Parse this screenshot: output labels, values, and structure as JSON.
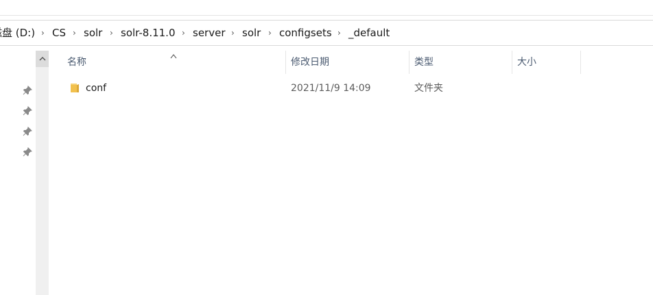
{
  "breadcrumb": {
    "items": [
      "磁盘 (D:)",
      "CS",
      "solr",
      "solr-8.11.0",
      "server",
      "solr",
      "configsets",
      "_default"
    ],
    "separator_icon": "chevron-right-icon"
  },
  "columns": {
    "name": "名称",
    "modified": "修改日期",
    "type": "类型",
    "size": "大小"
  },
  "files": [
    {
      "name": "conf",
      "modified": "2021/11/9 14:09",
      "type": "文件夹",
      "size": "",
      "icon": "folder-icon"
    }
  ],
  "quick_access_pins": 4,
  "colors": {
    "header_text": "#4a5a70",
    "folder": "#f2c14e",
    "folder_dark": "#dca93a"
  }
}
